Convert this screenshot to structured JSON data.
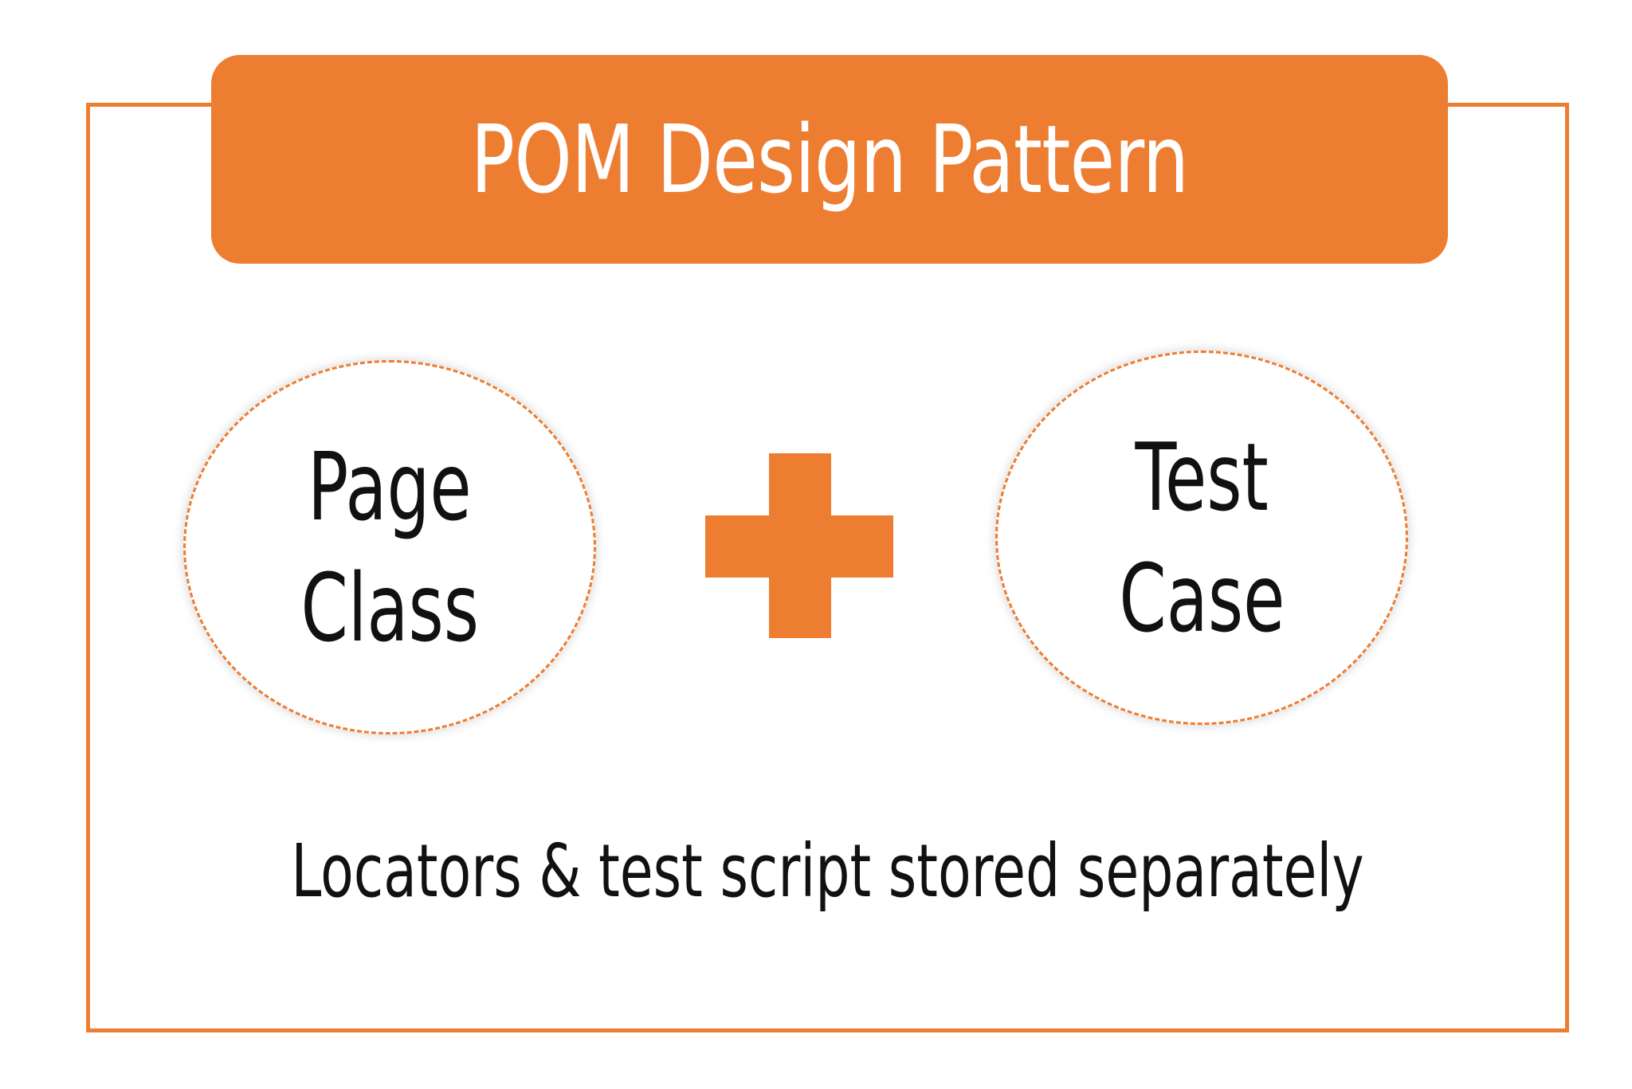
{
  "title": "POM  Design Pattern",
  "components": [
    {
      "lines": [
        "Page",
        "Class"
      ]
    },
    {
      "lines": [
        "Test",
        "Case"
      ]
    }
  ],
  "operator": "plus-icon",
  "caption": "Locators & test script stored separately",
  "colors": {
    "accent": "#ED7D31",
    "text": "#111111",
    "background": "#ffffff"
  }
}
